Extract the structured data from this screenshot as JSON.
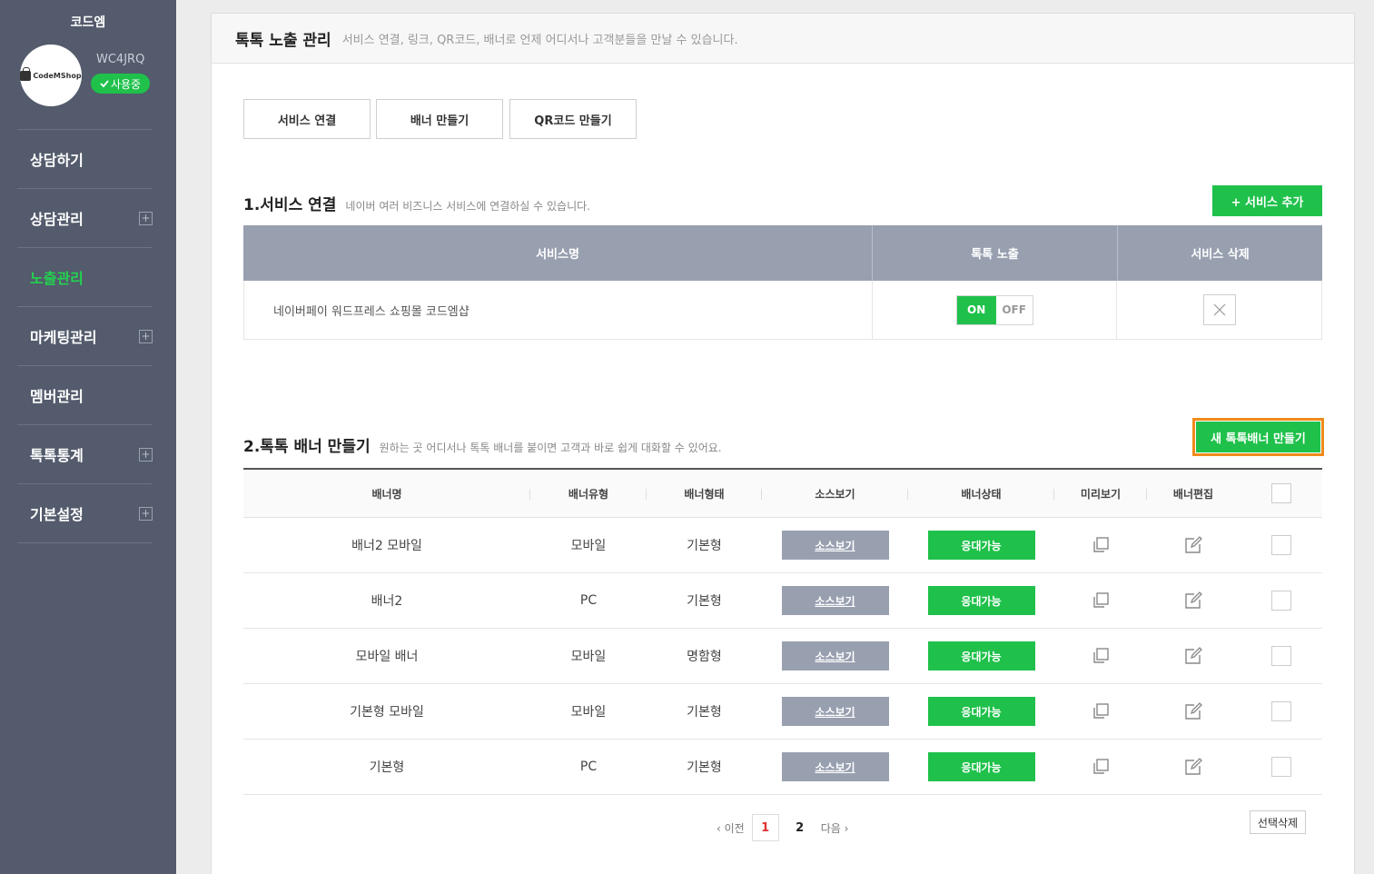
{
  "sidebar": {
    "brand": "코드엠",
    "avatar_text": "CodeMShop",
    "shop_code": "WC4JRQ",
    "status": "사용중",
    "nav": [
      {
        "label": "상담하기",
        "expandable": false,
        "active": false
      },
      {
        "label": "상담관리",
        "expandable": true,
        "active": false
      },
      {
        "label": "노출관리",
        "expandable": false,
        "active": true
      },
      {
        "label": "마케팅관리",
        "expandable": true,
        "active": false
      },
      {
        "label": "멤버관리",
        "expandable": false,
        "active": false
      },
      {
        "label": "톡톡통계",
        "expandable": true,
        "active": false
      },
      {
        "label": "기본설정",
        "expandable": true,
        "active": false
      }
    ],
    "plus_symbol": "+"
  },
  "header": {
    "title": "톡톡 노출 관리",
    "description": "서비스 연결, 링크, QR코드, 배너로 언제 어디서나 고객분들을 만날 수 있습니다."
  },
  "tabs": [
    "서비스 연결",
    "배너 만들기",
    "QR코드 만들기"
  ],
  "service_section": {
    "title": "1.서비스 연결",
    "description": "네이버 여러 비즈니스 서비스에 연결하실 수 있습니다.",
    "add_button": "+ 서비스 추가",
    "columns": [
      "서비스명",
      "톡톡 노출",
      "서비스 삭제"
    ],
    "rows": [
      {
        "name": "네이버페이 워드프레스 쇼핑몰 코드엠샵",
        "on_label": "ON",
        "off_label": "OFF",
        "state": "ON"
      }
    ]
  },
  "banner_section": {
    "title": "2.톡톡 배너 만들기",
    "description": "원하는 곳 어디서나 톡톡 배너를 붙이면 고객과 바로 쉽게 대화할 수 있어요.",
    "new_button": "새 톡톡배너 만들기",
    "columns": [
      "배너명",
      "배너유형",
      "배너형태",
      "소스보기",
      "배너상태",
      "미리보기",
      "배너편집"
    ],
    "rows": [
      {
        "name": "배너2 모바일",
        "type": "모바일",
        "form": "기본형",
        "source": "소스보기",
        "status": "응대가능"
      },
      {
        "name": "배너2",
        "type": "PC",
        "form": "기본형",
        "source": "소스보기",
        "status": "응대가능"
      },
      {
        "name": "모바일 배너",
        "type": "모바일",
        "form": "명함형",
        "source": "소스보기",
        "status": "응대가능"
      },
      {
        "name": "기본형 모바일",
        "type": "모바일",
        "form": "기본형",
        "source": "소스보기",
        "status": "응대가능"
      },
      {
        "name": "기본형",
        "type": "PC",
        "form": "기본형",
        "source": "소스보기",
        "status": "응대가능"
      }
    ]
  },
  "pagination": {
    "prev": "‹ 이전",
    "pages": [
      "1",
      "2"
    ],
    "current": "1",
    "next": "다음 ›"
  },
  "delete_selected": "선택삭제",
  "colors": {
    "sidebar": "#535b6c",
    "accent_green": "#1fc14b",
    "active_nav": "#23d24f",
    "table_head": "#98a0b0",
    "highlight_border": "#f08a1c",
    "current_page": "#e03131"
  }
}
